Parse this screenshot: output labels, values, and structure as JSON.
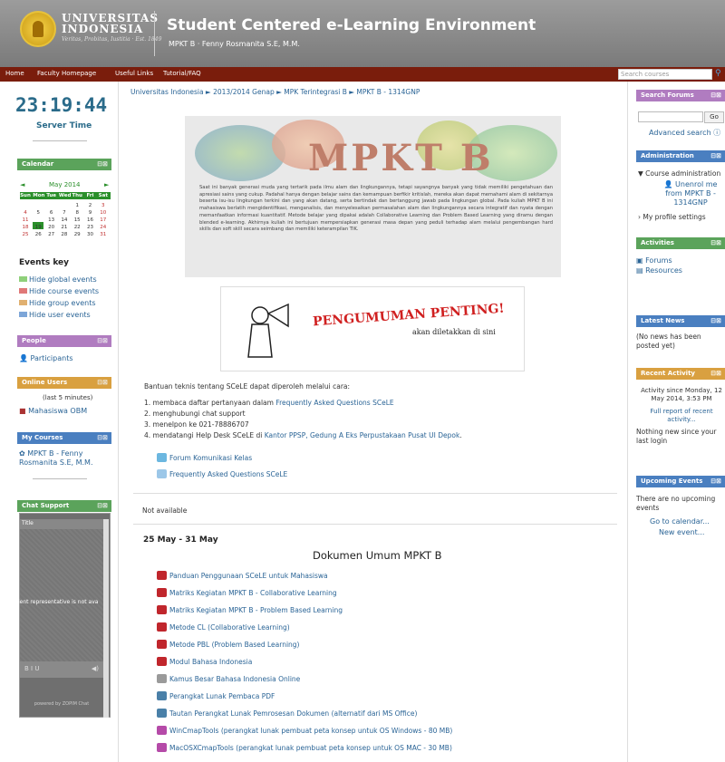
{
  "header": {
    "univ_line1": "UNIVERSITAS",
    "univ_line2": "INDONESIA",
    "motto": "Veritas, Probitas, Iustitia · Est. 1849",
    "title": "Student Centered e-Learning Environment",
    "subtitle": "MPKT B · Fenny Rosmanita S.E, M.M."
  },
  "nav": {
    "home": "Home",
    "faculty": "Faculty Homepage",
    "useful": "Useful Links",
    "tutorial": "Tutorial/FAQ",
    "search_placeholder": "Search courses"
  },
  "left": {
    "clock": "23:19:44",
    "server_time": "Server Time",
    "calendar": {
      "title": "Calendar",
      "month": "May 2014",
      "days": [
        "Sun",
        "Mon",
        "Tue",
        "Wed",
        "Thu",
        "Fri",
        "Sat"
      ],
      "weeks": [
        [
          "",
          "",
          "",
          "",
          "1",
          "2",
          "3"
        ],
        [
          "4",
          "5",
          "6",
          "7",
          "8",
          "9",
          "10"
        ],
        [
          "11",
          "12",
          "13",
          "14",
          "15",
          "16",
          "17"
        ],
        [
          "18",
          "19",
          "20",
          "21",
          "22",
          "23",
          "24"
        ],
        [
          "25",
          "26",
          "27",
          "28",
          "29",
          "30",
          "31"
        ]
      ],
      "today": "12"
    },
    "events_key": "Events key",
    "events": [
      "Hide global events",
      "Hide course events",
      "Hide group events",
      "Hide user events"
    ],
    "people": {
      "title": "People",
      "participants": "Participants"
    },
    "online": {
      "title": "Online Users",
      "last": "(last 5 minutes)",
      "user": "Mahasiswa OBM"
    },
    "courses": {
      "title": "My Courses",
      "course": "MPKT B - Fenny Rosmanita S.E, M.M."
    },
    "chat": {
      "title": "Chat Support",
      "window_title": "Title",
      "message": "ient representative is not ava",
      "tools": "B  I  U",
      "footer": "powered by ZOPIM Chat"
    }
  },
  "main": {
    "breadcrumb": "Universitas Indonesia ► 2013/2014 Genap ► MPK Terintegrasi B ► MPKT B - 1314GNP",
    "banner_title": "MPKT B",
    "banner_text": "Saat ini banyak generasi muda yang tertarik pada ilmu alam dan lingkungannya, tetapi sayangnya banyak yang tidak memiliki pengetahuan dan apresiasi sains yang cukup. Padahal hanya dengan belajar sains dan kemampuan berfikir kritislah, mereka akan dapat memahami alam di sekitarnya beserta isu-isu lingkungan terkini dan yang akan datang, serta bertindak dan bertanggung jawab pada lingkungan global. Pada kuliah MPKT B ini mahasiswa berlatih mengidentifikasi, menganalisis, dan menyelesaikan permasalahan alam dan lingkungannya secara integratif dan nyata dengan memanfaatkan informasi kuantitatif. Metode belajar yang dipakai adalah Collaborative Learning dan Problem Based Learning yang diramu dengan blended e-learning. Akhirnya kuliah ini bertujuan mempersiapkan generasi masa depan yang peduli terhadap alam melalui pengembangan hard skills dan soft skill secara seimbang dan memiliki keterampilan TIK.",
    "announce_title": "PENGUMUMAN PENTING!",
    "announce_sub": "akan diletakkan di sini",
    "help_intro": "Bantuan teknis tentang SCeLE dapat diperoleh melalui cara:",
    "help": [
      {
        "pre": "1.  membaca daftar pertanyaan dalam ",
        "link": "Frequently Asked Questions SCeLE"
      },
      {
        "pre": "2.  menghubungi chat support",
        "link": ""
      },
      {
        "pre": "3.  menelpon ke 021-78886707",
        "link": ""
      },
      {
        "pre": "4.  mendatangi Help Desk SCeLE di ",
        "link": "Kantor PPSP, Gedung A Eks Perpustakaan Pusat UI Depok",
        "post": "."
      }
    ],
    "forum": "Forum Komunikasi Kelas",
    "faq": "Frequently Asked Questions SCeLE",
    "not_available": "Not available",
    "week": "25 May - 31 May",
    "doc_title": "Dokumen Umum MPKT B",
    "docs": [
      "Panduan Penggunaan SCeLE untuk Mahasiswa",
      "Matriks Kegiatan MPKT B - Collaborative Learning",
      "Matriks Kegiatan MPKT B - Problem Based Learning",
      "Metode CL (Collaborative Learning)",
      "Metode PBL (Problem Based Learning)",
      "Modul Bahasa Indonesia",
      "Kamus Besar Bahasa Indonesia Online",
      "Perangkat Lunak Pembaca PDF",
      "Tautan Perangkat Lunak Pemrosesan Dokumen (alternatif dari MS Office)",
      "WinCmapTools (perangkat lunak pembuat peta konsep untuk OS Windows - 80 MB)",
      "MacOSXCmapTools (perangkat lunak pembuat peta konsep untuk OS MAC - 30 MB)"
    ]
  },
  "right": {
    "search_forums": "Search Forums",
    "go": "Go",
    "advanced": "Advanced search ⓘ",
    "admin": "Administration",
    "course_admin": "Course administration",
    "unenrol": "Unenrol me from MPKT B - 1314GNP",
    "profile": "My profile settings",
    "activities": "Activities",
    "forums": "Forums",
    "resources": "Resources",
    "news": "Latest News",
    "no_news": "(No news has been posted yet)",
    "recent": "Recent Activity",
    "since": "Activity since Monday, 12 May 2014, 3:53 PM",
    "full_report": "Full report of recent activity...",
    "nothing": "Nothing new since your last login",
    "upcoming": "Upcoming Events",
    "no_upcoming": "There are no upcoming events",
    "goto_cal": "Go to calendar...",
    "new_event": "New event..."
  },
  "colors": {
    "calendar": "#5ba35b",
    "people": "#b07cc0",
    "online": "#d9a040",
    "courses": "#4a7fc0",
    "chat": "#5ba35b",
    "search": "#b07cc0",
    "admin": "#4a7fc0",
    "activities": "#5ba35b",
    "news": "#4a7fc0",
    "recent": "#d9a040",
    "upcoming": "#4a7fc0",
    "nav": "#7a1d0c"
  }
}
